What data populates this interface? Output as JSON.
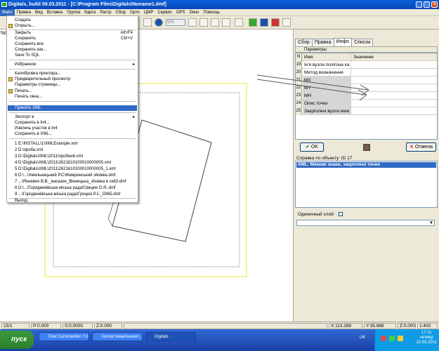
{
  "window": {
    "title": "Digitals, build 09.03.2011 - [C:\\Program Files\\Digitals\\Noname1.dmf]"
  },
  "menubar": [
    "Файл",
    "Правка",
    "Вид",
    "Вставка",
    "Группа",
    "Карта",
    "Растр",
    "Сбор",
    "Орто",
    "ЦМР",
    "Сервис",
    "GPS",
    "Окно",
    "Помощь"
  ],
  "toolbar": {
    "zoom_value": "500"
  },
  "canvas": {
    "label": "No"
  },
  "file_menu": {
    "items": [
      {
        "label": "Создать"
      },
      {
        "label": "Открыть..."
      },
      {
        "label": "Закрыть",
        "shortcut": "Alt+F4"
      },
      {
        "label": "Сохранить",
        "shortcut": "Ctrl+V"
      },
      {
        "label": "Сохранить все"
      },
      {
        "label": "Сохранить как..."
      },
      {
        "label": "Save To SQL"
      },
      {
        "label": "Избранное"
      },
      {
        "label": "Калибровка принтера..."
      },
      {
        "label": "Предварительный просмотр"
      },
      {
        "label": "Параметры страницы..."
      },
      {
        "label": "Печать..."
      },
      {
        "label": "Печать окна..."
      },
      {
        "label": "Принять XML"
      },
      {
        "label": "Экспорт в"
      },
      {
        "label": "Сохранить в In4..."
      },
      {
        "label": "Извлечь участок в In4"
      },
      {
        "label": "Сохранить в XML..."
      },
      {
        "label": "1 E:\\INSTALL\\1\\XMLExample.xml"
      },
      {
        "label": "2 D:\\проба.xml"
      },
      {
        "label": "3 D:\\Digitals\\XML\\2011\\пробний.xml"
      },
      {
        "label": "4 D:\\Digitals\\XML\\2011\\2621610100010000005.xml"
      },
      {
        "label": "5 D:\\Digitals\\XML\\2011\\2621610100010000005_1.xml"
      },
      {
        "label": "6 D:\\...\\Хмельницький Р.С\\Жмеринський зйомка.dmf"
      },
      {
        "label": "7 ...\\Яхневич В.В._магазин_Вінницька_зйомка в ск63.dmf"
      },
      {
        "label": "8 D:\\...\\Городенківська міська рада\\Грицюк О.Я..dmf"
      },
      {
        "label": "9 ...\\Городенківська міська рада\\Грицюк Р.1._ОЖБ.dmf"
      },
      {
        "label": "Выход"
      }
    ]
  },
  "right_panel": {
    "tabs": [
      "Сбор",
      "Правка",
      "Инфо",
      "Список"
    ],
    "params_label": "Параметры",
    "col_name": "Имя",
    "col_value": "Значение",
    "rows": [
      {
        "n": "19",
        "name": "Ін'я вузла полігона ка",
        "value": ""
      },
      {
        "n": "20",
        "name": "Метод визначення",
        "value": ""
      },
      {
        "n": "21",
        "name": "MX",
        "value": ""
      },
      {
        "n": "22",
        "name": "MY",
        "value": ""
      },
      {
        "n": "23",
        "name": "MH",
        "value": ""
      },
      {
        "n": "24",
        "name": "Опис точки",
        "value": ""
      },
      {
        "n": "25",
        "name": "Закріплені вузли меж",
        "value": ""
      }
    ],
    "ok_label": "OK",
    "cancel_label": "Отмена",
    "help_label": "Справка по объекту: ID 17",
    "help_selected": "XML: Межові знаки, закріплені точки",
    "layer_label": "Одиночный слой"
  },
  "status": {
    "cell": "15/1",
    "p": "P:0.000",
    "s": "S:0.0000",
    "z": "Z:0.000",
    "x": "X:113.288",
    "y": "Y:35.888",
    "z2": "Z:0.000",
    "scale": "1:400"
  },
  "taskbar": {
    "start": "пуск",
    "tasks": [
      "Total Commander 7.0...",
      "Геосистема/Аналит...",
      "Digitals"
    ],
    "lang": "UK",
    "time": "17:11",
    "day": "четвер",
    "date": "10.03.2011"
  },
  "colors": {
    "title": "#0a5fd9",
    "selection": "#316ac5",
    "taskbar": "#1941a5"
  }
}
